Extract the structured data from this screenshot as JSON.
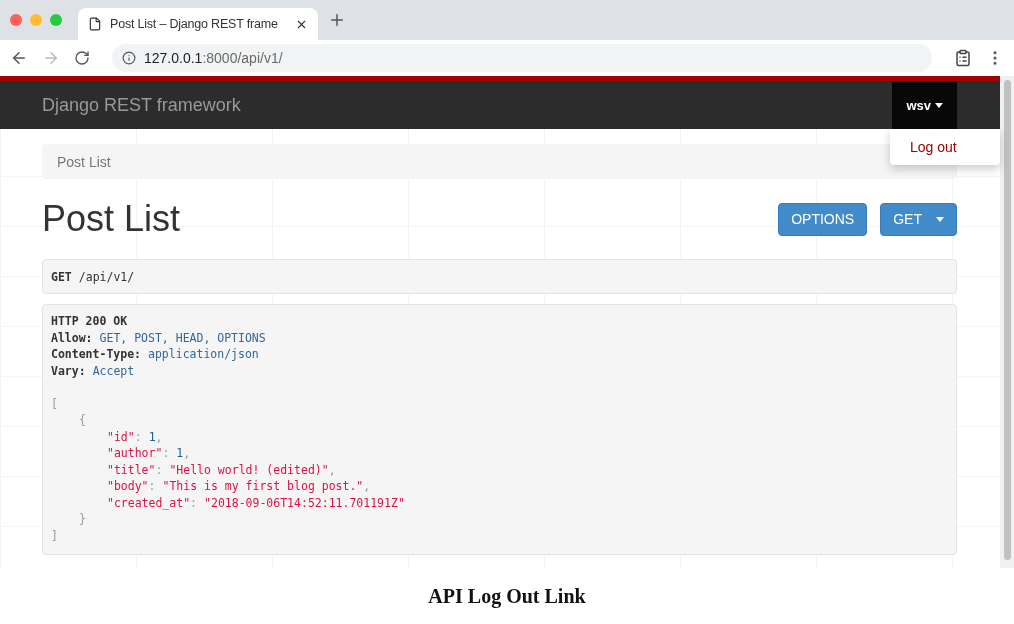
{
  "browser": {
    "tab": {
      "title": "Post List – Django REST frame",
      "selected": true
    },
    "address": {
      "host": "127.0.0.1",
      "path": ":8000/api/v1/"
    }
  },
  "navbar": {
    "brand": "Django REST framework",
    "user": {
      "name": "wsv",
      "expanded": true
    },
    "menu": [
      "Log out"
    ]
  },
  "breadcrumb": [
    "Post List"
  ],
  "title": "Post List",
  "buttons": [
    {
      "label": "OPTIONS",
      "kind": "plain"
    },
    {
      "label": "GET",
      "kind": "split"
    }
  ],
  "request": {
    "method": "GET",
    "path": "/api/v1/"
  },
  "response": {
    "status": "HTTP 200 OK",
    "headers": [
      {
        "name": "Allow:",
        "value": "GET, POST, HEAD, OPTIONS"
      },
      {
        "name": "Content-Type:",
        "value": "application/json"
      },
      {
        "name": "Vary:",
        "value": "Accept"
      }
    ],
    "open": "[",
    "item_open": "{",
    "fields": [
      {
        "key": "\"id\"",
        "sep": ":",
        "value": "1",
        "kind": "number",
        "comma": ","
      },
      {
        "key": "\"author\"",
        "sep": ":",
        "value": "1",
        "kind": "number",
        "comma": ","
      },
      {
        "key": "\"title\"",
        "sep": ":",
        "value": "\"Hello world! (edited)\"",
        "kind": "string",
        "comma": ","
      },
      {
        "key": "\"body\"",
        "sep": ":",
        "value": "\"This is my first blog post.\"",
        "kind": "string",
        "comma": ","
      },
      {
        "key": "\"created_at\"",
        "sep": ":",
        "value": "\"2018-09-06T14:52:11.701191Z\"",
        "kind": "string"
      }
    ],
    "item_close": "}",
    "close": "]"
  },
  "caption": "API Log Out Link"
}
